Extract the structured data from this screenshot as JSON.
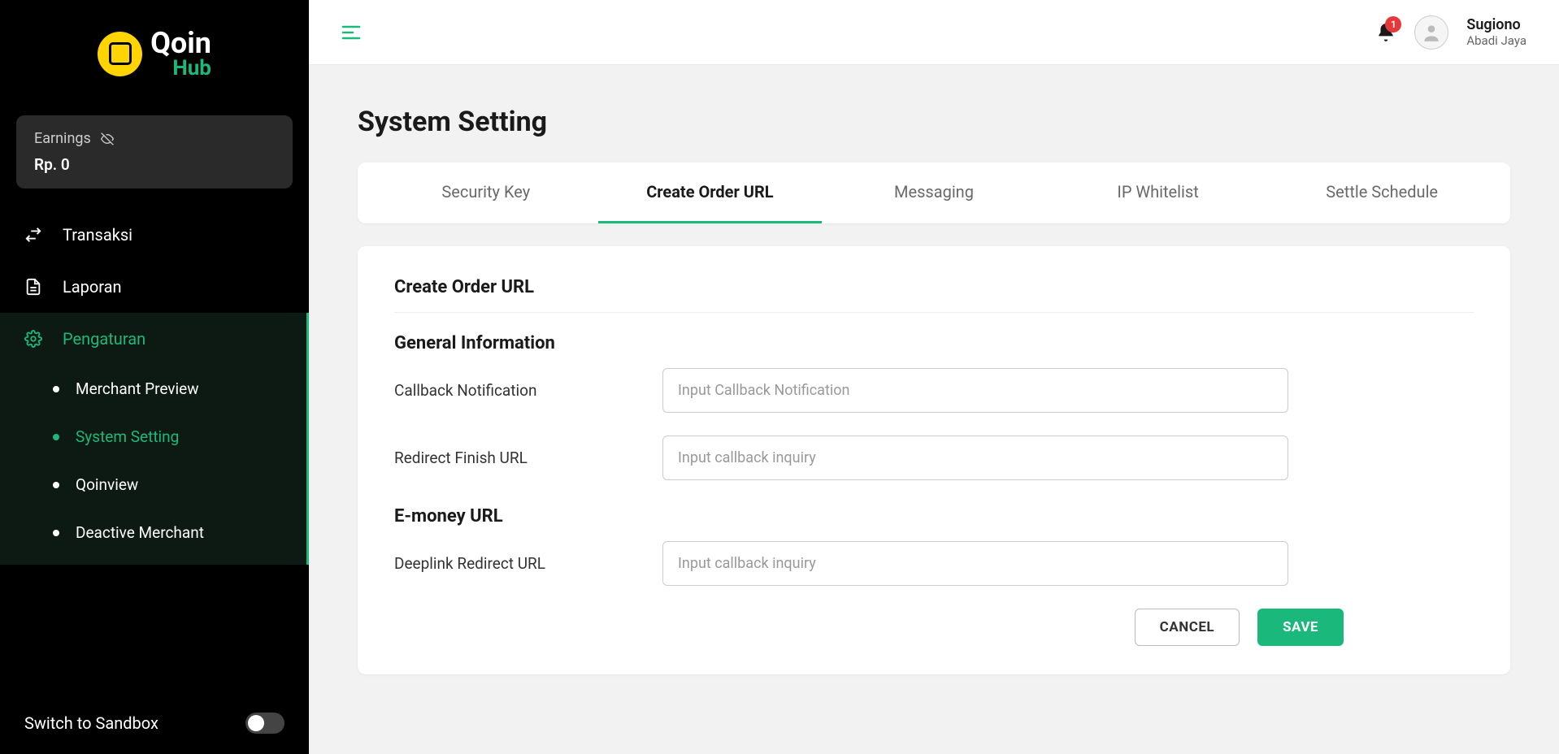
{
  "brand": {
    "name1": "Qoin",
    "name2": "Hub"
  },
  "earnings": {
    "label": "Earnings",
    "value": "Rp. 0"
  },
  "nav": {
    "transaksi": "Transaksi",
    "laporan": "Laporan",
    "pengaturan": "Pengaturan",
    "sub": {
      "merchant_preview": "Merchant Preview",
      "system_setting": "System Setting",
      "qoinview": "Qoinview",
      "deactive_merchant": "Deactive Merchant"
    }
  },
  "sandbox": {
    "label": "Switch to Sandbox"
  },
  "topbar": {
    "notif_count": "1",
    "user_name": "Sugiono",
    "user_sub": "Abadi Jaya"
  },
  "page": {
    "title": "System Setting"
  },
  "tabs": {
    "security_key": "Security Key",
    "create_order_url": "Create Order URL",
    "messaging": "Messaging",
    "ip_whitelist": "IP Whitelist",
    "settle_schedule": "Settle Schedule"
  },
  "card": {
    "title": "Create Order URL",
    "section_general": "General Information",
    "section_emoney": "E-money URL",
    "fields": {
      "callback_notification": {
        "label": "Callback Notification",
        "placeholder": "Input Callback Notification"
      },
      "redirect_finish": {
        "label": "Redirect Finish URL",
        "placeholder": "Input callback inquiry"
      },
      "deeplink_redirect": {
        "label": "Deeplink Redirect URL",
        "placeholder": "Input callback inquiry"
      }
    },
    "buttons": {
      "cancel": "CANCEL",
      "save": "SAVE"
    }
  }
}
